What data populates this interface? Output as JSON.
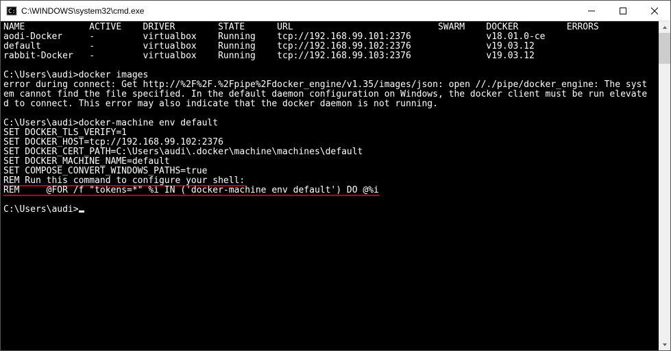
{
  "window": {
    "title": "C:\\WINDOWS\\system32\\cmd.exe"
  },
  "table": {
    "headers": [
      "NAME",
      "ACTIVE",
      "DRIVER",
      "STATE",
      "URL",
      "SWARM",
      "DOCKER",
      "ERRORS"
    ],
    "rows": [
      {
        "name": "aodi-Docker",
        "active": "-",
        "driver": "virtualbox",
        "state": "Running",
        "url": "tcp://192.168.99.101:2376",
        "swarm": "",
        "docker": "v18.01.0-ce",
        "errors": ""
      },
      {
        "name": "default",
        "active": "-",
        "driver": "virtualbox",
        "state": "Running",
        "url": "tcp://192.168.99.102:2376",
        "swarm": "",
        "docker": "v19.03.12",
        "errors": ""
      },
      {
        "name": "rabbit-Docker",
        "active": "-",
        "driver": "virtualbox",
        "state": "Running",
        "url": "tcp://192.168.99.103:2376",
        "swarm": "",
        "docker": "v19.03.12",
        "errors": ""
      }
    ]
  },
  "prompts": {
    "p1": "C:\\Users\\audi>",
    "cmd1": "docker images",
    "err": "error during connect: Get http://%2F%2F.%2Fpipe%2Fdocker_engine/v1.35/images/json: open //./pipe/docker_engine: The syst\nem cannot find the file specified. In the default daemon configuration on Windows, the docker client must be run elevate\nd to connect. This error may also indicate that the docker daemon is not running.",
    "p2": "C:\\Users\\audi>",
    "cmd2": "docker-machine env default",
    "env1": "SET DOCKER_TLS_VERIFY=1",
    "env2": "SET DOCKER_HOST=tcp://192.168.99.102:2376",
    "env3": "SET DOCKER_CERT_PATH=C:\\Users\\audi\\.docker\\machine\\machines\\default",
    "env4": "SET DOCKER_MACHINE_NAME=default",
    "env5": "SET COMPOSE_CONVERT_WINDOWS_PATHS=true",
    "rem1": "REM Run this command to configure your shell:",
    "rem2": "REM     @FOR /f \"tokens=*\" %i IN ('docker-machine env default') DO @%i",
    "p3": "C:\\Users\\audi>"
  }
}
